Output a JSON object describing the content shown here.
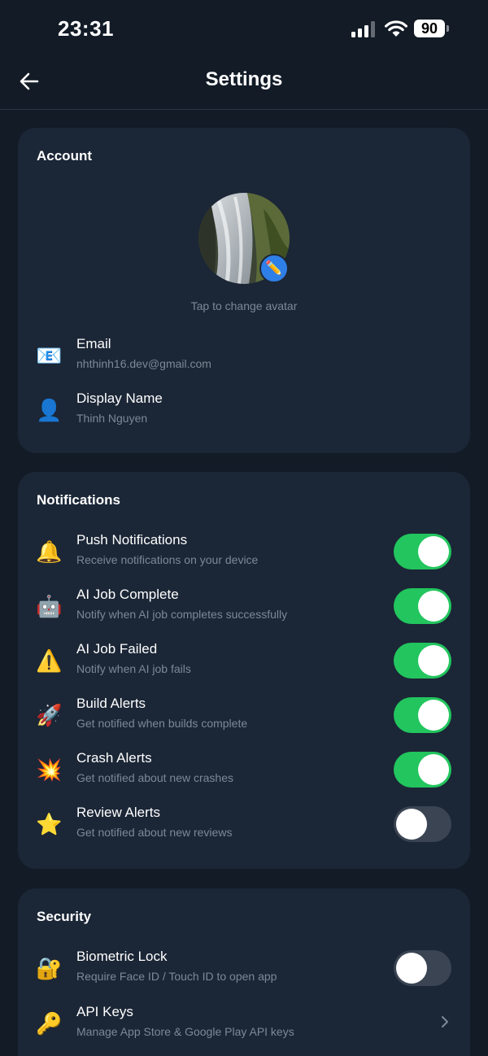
{
  "status_bar": {
    "time": "23:31",
    "battery": "90"
  },
  "header": {
    "title": "Settings"
  },
  "account": {
    "title": "Account",
    "avatar_hint": "Tap to change avatar",
    "rows": [
      {
        "label": "Email",
        "value": "nhthinh16.dev@gmail.com",
        "icon": "envelope-icon",
        "glyph": "📧"
      },
      {
        "label": "Display Name",
        "value": "Thinh Nguyen",
        "icon": "person-icon",
        "glyph": "👤"
      }
    ]
  },
  "notifications": {
    "title": "Notifications",
    "items": [
      {
        "label": "Push Notifications",
        "desc": "Receive notifications on your device",
        "icon": "bell-icon",
        "glyph": "🔔",
        "enabled": true
      },
      {
        "label": "AI Job Complete",
        "desc": "Notify when AI job completes successfully",
        "icon": "robot-icon",
        "glyph": "🤖",
        "enabled": true
      },
      {
        "label": "AI Job Failed",
        "desc": "Notify when AI job fails",
        "icon": "warning-icon",
        "glyph": "⚠️",
        "enabled": true
      },
      {
        "label": "Build Alerts",
        "desc": "Get notified when builds complete",
        "icon": "rocket-icon",
        "glyph": "🚀",
        "enabled": true
      },
      {
        "label": "Crash Alerts",
        "desc": "Get notified about new crashes",
        "icon": "collision-icon",
        "glyph": "💥",
        "enabled": true
      },
      {
        "label": "Review Alerts",
        "desc": "Get notified about new reviews",
        "icon": "star-icon",
        "glyph": "⭐",
        "enabled": false
      }
    ]
  },
  "security": {
    "title": "Security",
    "biometric": {
      "label": "Biometric Lock",
      "desc": "Require Face ID / Touch ID to open app",
      "icon": "lock-icon",
      "glyph": "🔐",
      "enabled": false
    },
    "api_keys": {
      "label": "API Keys",
      "desc": "Manage App Store & Google Play API keys",
      "icon": "key-icon",
      "glyph": "🔑"
    }
  },
  "colors": {
    "background": "#121b26",
    "card": "#1b2636",
    "toggle_on": "#22c55e",
    "toggle_off": "#3a4453",
    "accent": "#2f7fe8"
  }
}
